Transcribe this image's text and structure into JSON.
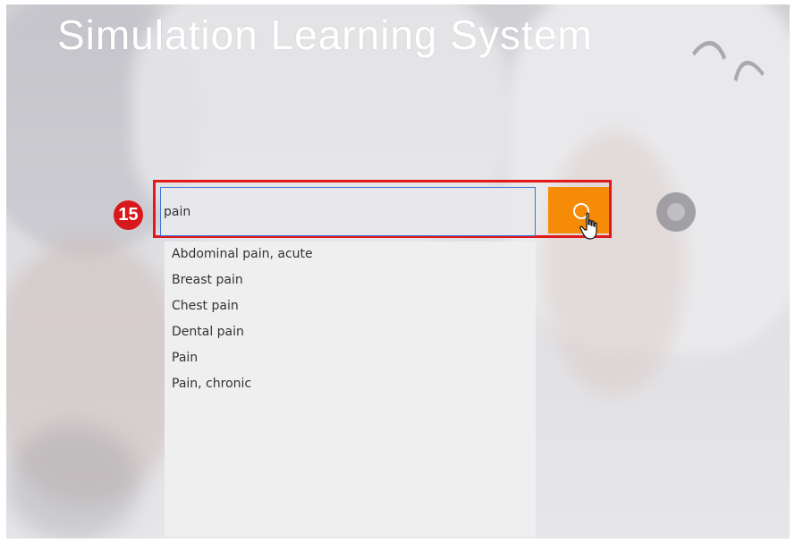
{
  "header": {
    "title": "Simulation Learning System"
  },
  "annotation": {
    "step_number": "15"
  },
  "search": {
    "value": "pain",
    "button_icon": "search-icon"
  },
  "suggestions": [
    "Abdominal pain, acute",
    "Breast pain",
    "Chest pain",
    "Dental pain",
    "Pain",
    "Pain, chronic"
  ],
  "colors": {
    "search_button": "#f58b06",
    "highlight_border": "#e0191b",
    "step_badge": "#d8191c"
  }
}
